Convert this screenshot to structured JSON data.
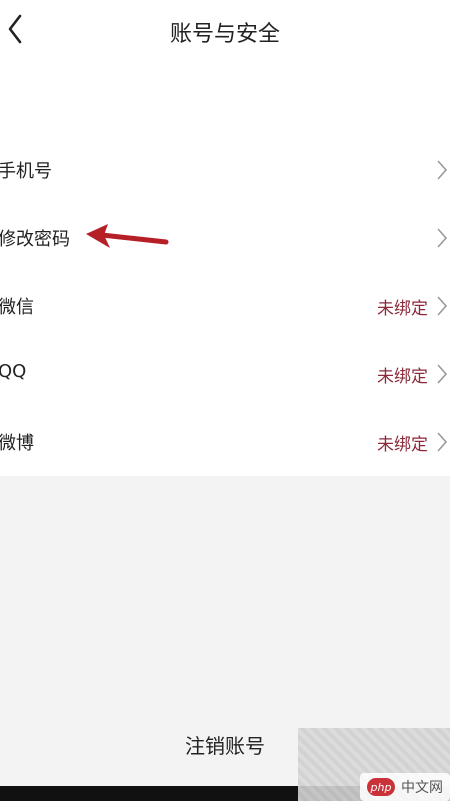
{
  "header": {
    "title": "账号与安全"
  },
  "settings": {
    "items": [
      {
        "label": "手机号",
        "status": ""
      },
      {
        "label": "修改密码",
        "status": ""
      },
      {
        "label": "微信",
        "status": "未绑定"
      },
      {
        "label": "QQ",
        "status": "未绑定"
      },
      {
        "label": "微博",
        "status": "未绑定"
      }
    ]
  },
  "footer": {
    "logout_label": "注销账号"
  },
  "watermark": {
    "badge": "php",
    "site": "中文网"
  },
  "colors": {
    "status_text": "#8a2a3a",
    "annotation_arrow": "#b51f25",
    "page_background": "#f3f3f3"
  },
  "icons": [
    "back-icon",
    "chevron-right-icon",
    "annotation-arrow"
  ]
}
